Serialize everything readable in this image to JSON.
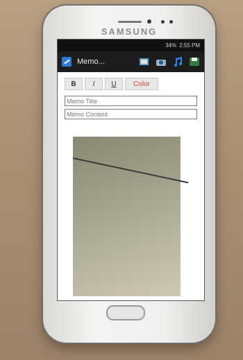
{
  "device": {
    "brand": "SAMSUNG"
  },
  "status": {
    "signal": "34%",
    "time": "2:55 PM"
  },
  "actionbar": {
    "app_title": "Memo...",
    "icons": [
      "gallery-icon",
      "camera-icon",
      "music-icon",
      "save-icon"
    ]
  },
  "toolbar": {
    "bold": "B",
    "italic": "I",
    "underline": "U",
    "color": "Color"
  },
  "fields": {
    "title": "Memo Title",
    "content": "Memo Content"
  }
}
